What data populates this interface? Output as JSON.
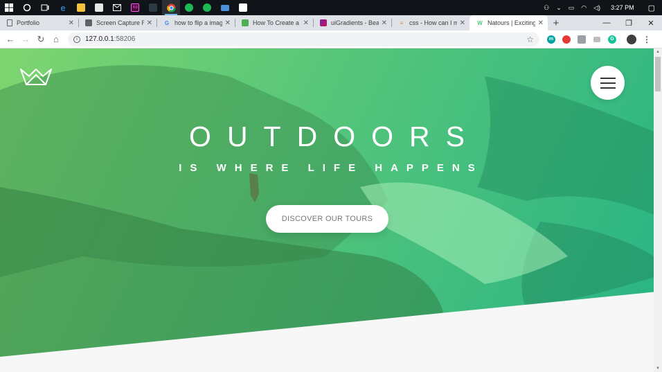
{
  "taskbar": {
    "time": "3:27 PM",
    "apps": [
      "start-icon",
      "cortana-icon",
      "task-view-icon",
      "edge-icon",
      "file-explorer-icon",
      "store-icon",
      "mail-icon",
      "adobe-xd-icon",
      "terminal-icon",
      "chrome-icon",
      "spotify-icon",
      "spotify-icon",
      "monitor-icon",
      "photos-icon"
    ]
  },
  "tabs": [
    {
      "title": "Portfolio",
      "icon": "page-icon",
      "color": "#5f6368"
    },
    {
      "title": "Screen Capture Re",
      "icon": "camera-icon",
      "color": "#5f6368"
    },
    {
      "title": "how to flip a imag",
      "icon": "google-icon",
      "color": "#4285f4"
    },
    {
      "title": "How To Create a F",
      "icon": "w3schools-icon",
      "color": "#4caf50"
    },
    {
      "title": "uiGradients - Beau",
      "icon": "uigradients-icon",
      "color": "#c2185b"
    },
    {
      "title": "css - How can I m",
      "icon": "stackoverflow-icon",
      "color": "#f48024"
    },
    {
      "title": "Natours | Exciting",
      "icon": "natours-icon",
      "color": "#55c57a"
    }
  ],
  "address": {
    "host": "127.0.0.1",
    "port": ":58206"
  },
  "hero": {
    "title": "OUTDOORS",
    "subtitle": "IS WHERE LIFE HAPPENS",
    "cta": "DISCOVER OUR TOURS"
  },
  "colors": {
    "gradient_light": "#7ed56f",
    "gradient_dark": "#28b485",
    "accent": "#55c57a"
  }
}
